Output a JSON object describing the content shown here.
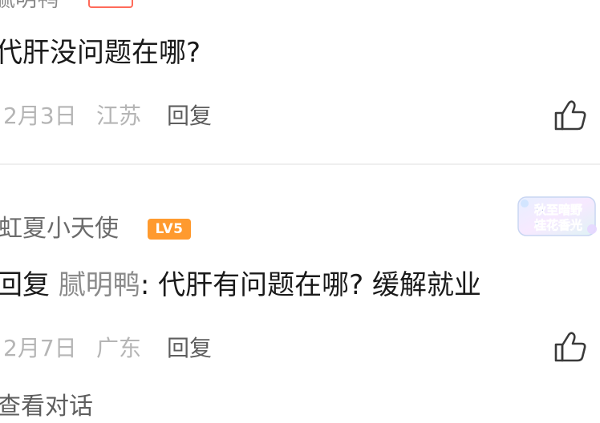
{
  "comments": [
    {
      "username": "腻明鸭",
      "badge": "",
      "text": "代肝没问题在哪?",
      "date": "2月3日",
      "location": "江苏",
      "reply_label": "回复"
    },
    {
      "username": "虹夏小天使",
      "badge": "LV5",
      "reply_prefix": "回复",
      "mention": "腻明鸭",
      "text": ": 代肝有问题在哪? 缓解就业",
      "date": "2月7日",
      "location": "广东",
      "reply_label": "回复",
      "medal_text": [
        "秋至暗野",
        "桂花香光"
      ],
      "view_conversation": "查看对话"
    }
  ],
  "colors": {
    "name_gray": "#6b6b6b",
    "meta_gray": "#b5b5b5",
    "badge_orange": "#ff9a2e",
    "badge_red_outline": "#ff6b5a"
  },
  "icons": {
    "like": "thumbs-up-icon"
  }
}
